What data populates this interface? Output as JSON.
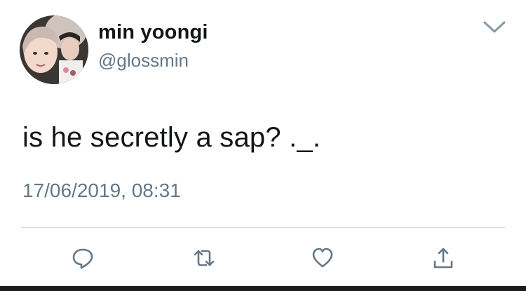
{
  "tweet": {
    "display_name": "min yoongi",
    "handle": "@glossmin",
    "text": "is he secretly a sap? ._.",
    "timestamp": "17/06/2019, 08:31"
  },
  "icons": {
    "menu": "chevron-down-icon",
    "reply": "reply-icon",
    "retweet": "retweet-icon",
    "like": "heart-icon",
    "share": "share-icon"
  },
  "colors": {
    "text": "#14171a",
    "secondary": "#657786",
    "icon": "#657786",
    "divider": "#d6dbdf"
  }
}
